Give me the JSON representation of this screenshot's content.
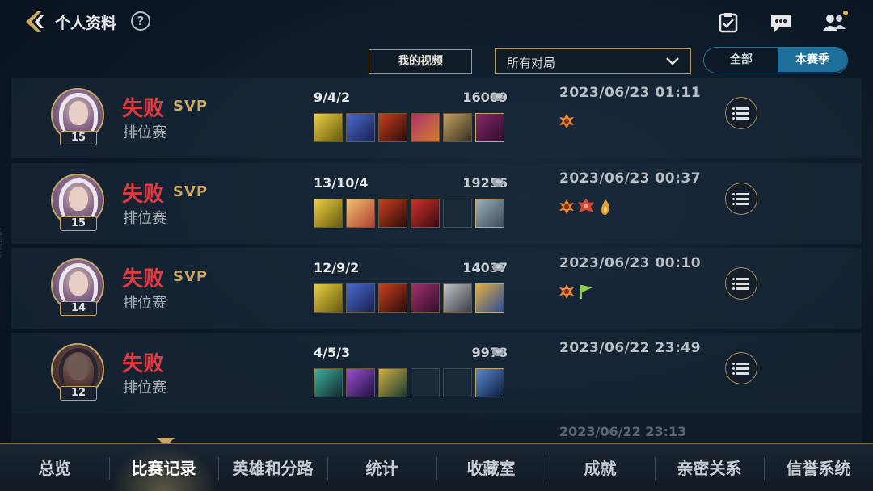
{
  "header": {
    "title": "个人资料",
    "help_label": "?"
  },
  "filters": {
    "my_video_label": "我的视频",
    "match_filter_value": "所有对局",
    "toggle_all": "全部",
    "toggle_season": "本赛季"
  },
  "matches": [
    {
      "result": "失败",
      "svp": "SVP",
      "mode": "排位赛",
      "level": "15",
      "kda": "9/4/2",
      "gold": "16009",
      "datetime": "2023/06/23 01:11",
      "items": [
        "item-gold-tri",
        "item-blue-mech",
        "item-red-blade",
        "item-purple-spear",
        "item-gold-shard",
        "item-purple-boot"
      ],
      "badges": [
        "mvp-orange-badge"
      ]
    },
    {
      "result": "失败",
      "svp": "SVP",
      "mode": "排位赛",
      "level": "15",
      "kda": "13/10/4",
      "gold": "19256",
      "datetime": "2023/06/23 00:37",
      "items": [
        "item-gold-tri",
        "item-angel-wing",
        "item-red-blade",
        "item-red-gauntlet",
        "empty",
        "item-silver-armor"
      ],
      "badges": [
        "mvp-orange-badge",
        "red-crest-badge",
        "flame-badge"
      ]
    },
    {
      "result": "失败",
      "svp": "SVP",
      "mode": "排位赛",
      "level": "14",
      "kda": "12/9/2",
      "gold": "14037",
      "datetime": "2023/06/23 00:10",
      "items": [
        "item-gold-tri",
        "item-blue-mech",
        "item-red-blade",
        "item-purple-fist",
        "item-silver-sword",
        "item-gold-key"
      ],
      "badges": [
        "mvp-orange-badge",
        "green-flag-badge"
      ]
    },
    {
      "result": "失败",
      "svp": "",
      "mode": "排位赛",
      "level": "12",
      "kda": "4/5/3",
      "gold": "9978",
      "datetime": "2023/06/22 23:49",
      "items": [
        "item-teal-crossbow",
        "item-purple-sword",
        "item-gold-trident",
        "empty",
        "empty",
        "item-blue-ward"
      ],
      "badges": []
    }
  ],
  "faded_row": {
    "datetime": "2023/06/22 23:13"
  },
  "nav": {
    "tabs": [
      "总览",
      "比赛记录",
      "英雄和分路",
      "统计",
      "收藏室",
      "成就",
      "亲密关系",
      "信誉系统"
    ],
    "active_index": 1
  },
  "side_id": "4ZJZ7LIC"
}
